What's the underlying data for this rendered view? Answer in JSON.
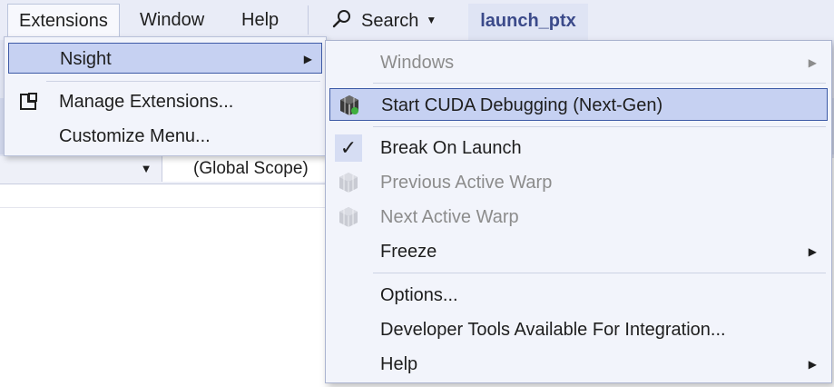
{
  "menubar": {
    "items": [
      {
        "label": "Extensions"
      },
      {
        "label": "Window"
      },
      {
        "label": "Help"
      },
      {
        "label": "Search"
      }
    ],
    "document_tab": "launch_ptx"
  },
  "editor": {
    "scope": "(Global Scope)"
  },
  "extensions_menu": {
    "items": [
      {
        "label": "Nsight",
        "icon": "none",
        "has_submenu": true,
        "highlighted": true
      },
      {
        "label": "Manage Extensions...",
        "icon": "extensions-icon"
      },
      {
        "label": "Customize Menu...",
        "icon": "none"
      }
    ]
  },
  "nsight_menu": {
    "items": [
      {
        "label": "Windows",
        "disabled": true,
        "has_submenu": true
      },
      {
        "label": "Start CUDA Debugging (Next-Gen)",
        "icon": "cuda-cube-icon",
        "highlighted": true
      },
      {
        "label": "Break On Launch",
        "checked": true
      },
      {
        "label": "Previous Active Warp",
        "disabled": true,
        "icon": "cuda-cube-icon"
      },
      {
        "label": "Next Active Warp",
        "disabled": true,
        "icon": "cuda-cube-icon"
      },
      {
        "label": "Freeze",
        "has_submenu": true
      },
      {
        "label": "Options..."
      },
      {
        "label": "Developer Tools Available For Integration..."
      },
      {
        "label": "Help",
        "has_submenu": true
      }
    ]
  },
  "colors": {
    "menubar_bg": "#e9ecf7",
    "menu_bg": "#f2f4fb",
    "highlight_bg": "#c6d1f2",
    "highlight_border": "#3d5aa6",
    "tab_text": "#3b4a8a"
  }
}
